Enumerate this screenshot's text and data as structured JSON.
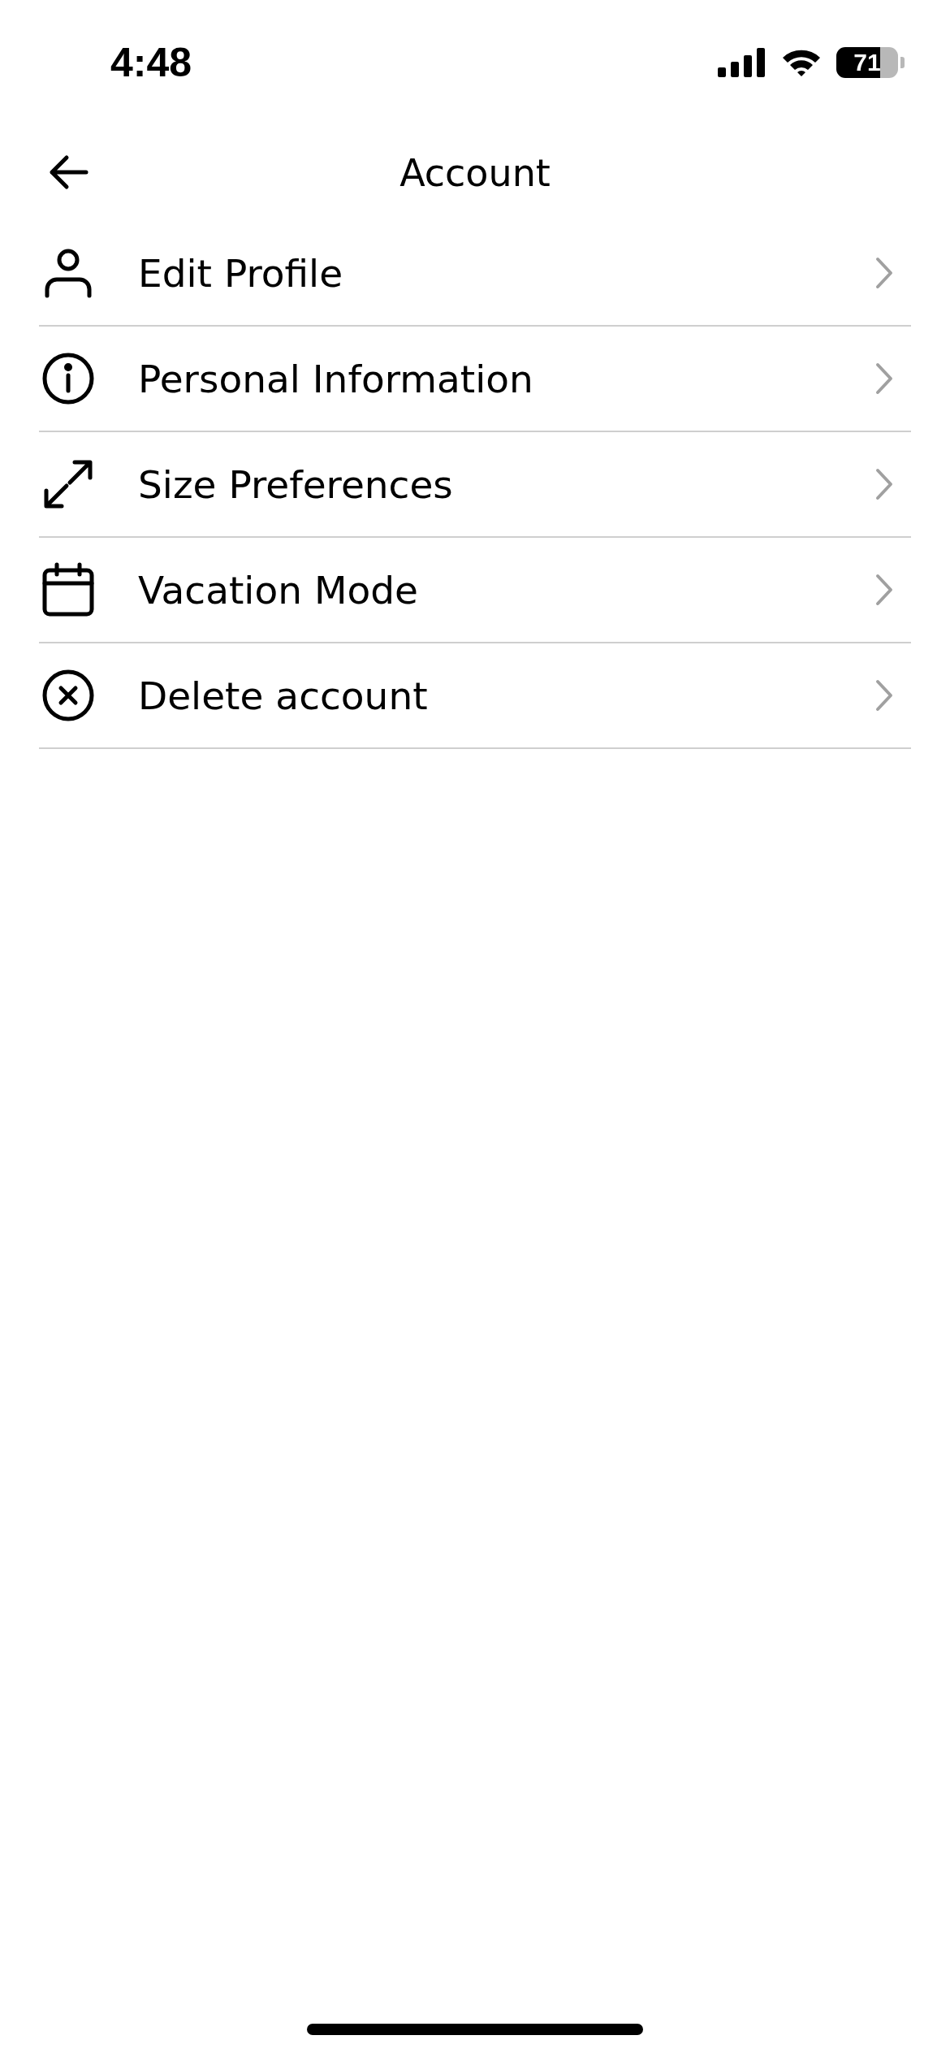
{
  "status_bar": {
    "time": "4:48",
    "battery": "71"
  },
  "header": {
    "title": "Account"
  },
  "menu": [
    {
      "label": "Edit Profile"
    },
    {
      "label": "Personal Information"
    },
    {
      "label": "Size Preferences"
    },
    {
      "label": "Vacation Mode"
    },
    {
      "label": "Delete account"
    }
  ]
}
